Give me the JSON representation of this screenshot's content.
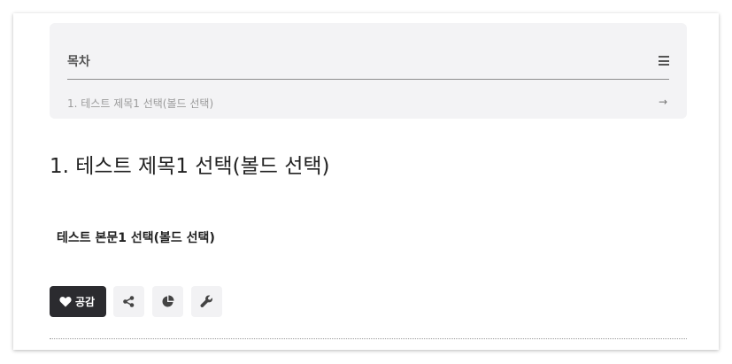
{
  "toc": {
    "title": "목차",
    "items": [
      {
        "label": "1. 테스트 제목1 선택(볼드 선택)"
      }
    ]
  },
  "post": {
    "heading": "1. 테스트 제목1 선택(볼드 선택)",
    "body": "테스트 본문1 선택(볼드 선택)"
  },
  "actions": {
    "like_label": "공감"
  },
  "icons": {
    "toc_menu": "menu-icon",
    "toc_arrow": "arrow-right-icon",
    "like": "heart-icon",
    "share": "share-icon",
    "stats": "pie-chart-icon",
    "tool": "wrench-icon"
  },
  "colors": {
    "toc_background": "#f3f3f5",
    "like_button_background": "#2b2b2f",
    "action_button_background": "#f2f2f4"
  }
}
